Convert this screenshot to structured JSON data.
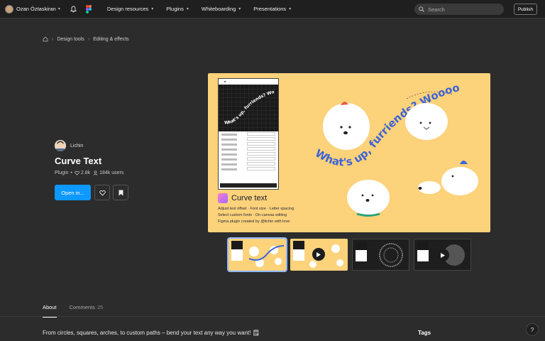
{
  "topbar": {
    "user_name": "Ozan Öztaskiran",
    "nav": [
      {
        "label": "Design resources"
      },
      {
        "label": "Plugins"
      },
      {
        "label": "Whiteboarding"
      },
      {
        "label": "Presentations"
      }
    ],
    "search_placeholder": "Search",
    "publish_label": "Publish"
  },
  "breadcrumb": {
    "items": [
      "Design tools",
      "Editing & effects"
    ]
  },
  "plugin": {
    "author": "Lichin",
    "title": "Curve Text",
    "type": "Plugin",
    "likes": "2.8k",
    "users": "184k users",
    "open_label": "Open in...",
    "accent_color": "#0d99ff"
  },
  "hero": {
    "brand_name": "Curve text",
    "curve_phrase": "What's up, furriends? Woooof!",
    "window_phrase": "What's up, furriends? Woooof!",
    "desc_lines": [
      "Adjust text offset · Font size · Letter spacing",
      "Select custom fonts · On-canvas editing",
      "Figma plugin created by @lichin with love"
    ],
    "background_color": "#fcd27a"
  },
  "tabs": [
    {
      "label": "About"
    },
    {
      "label": "Comments",
      "count": "25"
    }
  ],
  "about": {
    "text": "From circles, squares, arches, to custom paths – bend your text any way you want! 🗒"
  },
  "sidebar": {
    "tags_heading": "Tags"
  },
  "help_label": "?"
}
